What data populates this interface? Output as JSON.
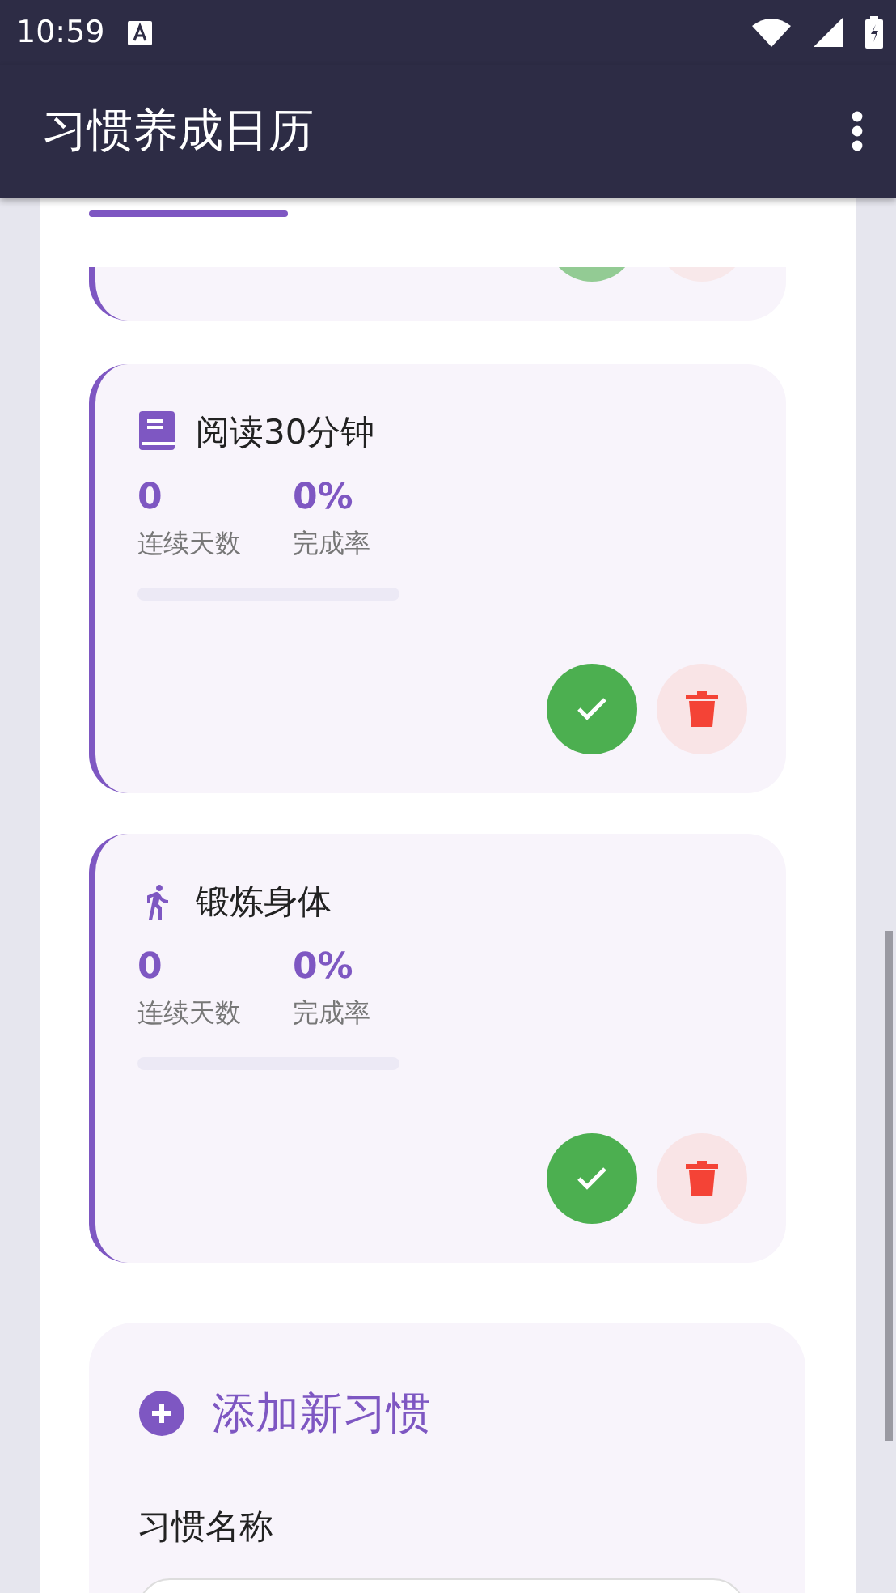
{
  "status_bar": {
    "time": "10:59"
  },
  "app_bar": {
    "title": "习惯养成日历"
  },
  "tab_indicator": {
    "level": 1
  },
  "habits": [
    {
      "kind": "clipped"
    },
    {
      "kind": "reading",
      "name": "阅读30分钟",
      "streak": "0",
      "streak_label": "连续天数",
      "rate": "0%",
      "rate_label": "完成率",
      "level": 0
    },
    {
      "kind": "exercise",
      "name": "锻炼身体",
      "streak": "0",
      "streak_label": "连续天数",
      "rate": "0%",
      "rate_label": "完成率",
      "level": 0
    }
  ],
  "add_habit": {
    "title": "添加新习惯",
    "name_label": "习惯名称"
  }
}
